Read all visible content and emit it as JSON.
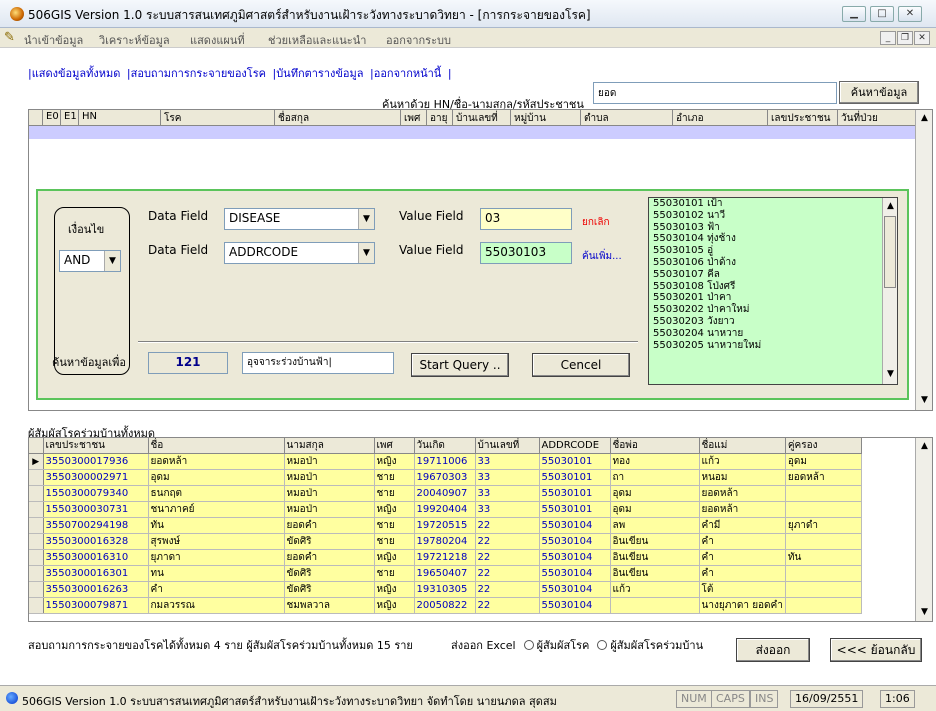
{
  "window": {
    "title": "506GIS Version 1.0  ระบบสารสนเทศภูมิศาสตร์สำหรับงานเฝ้าระวังทางระบาดวิทยา - [การกระจายของโรค]"
  },
  "menu": [
    "นำเข้าข้อมูล",
    "วิเคราะห์ข้อมูล",
    "แสดงแผนที่",
    "ช่วยเหลือและแนะนำ",
    "ออกจากระบบ"
  ],
  "nav": [
    "|แสดงข้อมูลทั้งหมด",
    "|สอบถามการกระจายของโรค",
    "|บันทึกตารางข้อมูล",
    "|ออกจากหน้านี้",
    "|"
  ],
  "search": {
    "label": "ค้นหาด้วย HN/ชื่อ-นามสกุล/รหัสประชาชน",
    "value": "ยอด",
    "button": "ค้นหาข้อมูล"
  },
  "grid1": {
    "headers": [
      "E0",
      "E1",
      "HN",
      "โรค",
      "ชื่อสกุล",
      "เพศ",
      "อายุ",
      "บ้านเลขที่",
      "หมู่บ้าน",
      "ตำบล",
      "อำเภอ",
      "เลขประชาชน",
      "วันที่ป่วย"
    ]
  },
  "query": {
    "condition_label": "เงื่อนไข",
    "operator": "AND",
    "data_field_label": "Data Field",
    "value_field_label": "Value Field",
    "field1": "DISEASE",
    "value1": "03",
    "cancel_link": "ยกเลิก",
    "field2": "ADDRCODE",
    "value2": "55030103",
    "more_link": "ค้นเพิ่ม...",
    "purpose_label": "ค้นหาข้อมูลเพื่อ",
    "count": "121",
    "purpose_value": "อุจจาระร่วงบ้านฟ้า|",
    "start_button": "Start Query ..",
    "cancel_button": "Cencel"
  },
  "villages": [
    "55030101 เป้า",
    "55030102 นาวี",
    "55030103 ฟ้า",
    "55030104 ทุ่งช้าง",
    "55030105 อู่",
    "55030106 ป่าด้าง",
    "55030107 คีล",
    "55030108 โป่งศรี",
    "55030201 ป่าคา",
    "55030202 ป่าคาใหม่",
    "55030203 วังยาว",
    "55030204 นาหวาย",
    "55030205 นาหวายใหม่"
  ],
  "grid2": {
    "label": "ผู้สัมผัสโรคร่วมบ้านทั้งหมด",
    "headers": [
      "เลขประชาชน",
      "ชื่อ",
      "นามสกุล",
      "เพศ",
      "วันเกิด",
      "บ้านเลขที่",
      "ADDRCODE",
      "ชื่อพ่อ",
      "ชื่อแม่",
      "คู่ครอง"
    ],
    "rows": [
      [
        "3550300017936",
        "ยอดหล้า",
        "หมอป่า",
        "หญิง",
        "19711006",
        "33",
        "55030101",
        "ทอง",
        "แก้ว",
        "อุดม"
      ],
      [
        "3550300002971",
        "อุดม",
        "หมอป่า",
        "ชาย",
        "19670303",
        "33",
        "55030101",
        "ถา",
        "หนอม",
        "ยอดหล้า"
      ],
      [
        "1550300079340",
        "ธนกฤต",
        "หมอป่า",
        "ชาย",
        "20040907",
        "33",
        "55030101",
        "อุดม",
        "ยอดหล้า",
        ""
      ],
      [
        "1550300030731",
        "ชนาภาคย์",
        "หมอป่า",
        "หญิง",
        "19920404",
        "33",
        "55030101",
        "อุดม",
        "ยอดหล้า",
        ""
      ],
      [
        "3550700294198",
        "ทัน",
        "ยอดคำ",
        "ชาย",
        "19720515",
        "22",
        "55030104",
        "ลพ",
        "คำมี",
        "ยุภาดำ"
      ],
      [
        "3550300016328",
        "สุรพงษ์",
        "ขัดศิริ",
        "ชาย",
        "19780204",
        "22",
        "55030104",
        "อินเขียน",
        "คำ",
        ""
      ],
      [
        "3550300016310",
        "ยุภาดา",
        "ยอดคำ",
        "หญิง",
        "19721218",
        "22",
        "55030104",
        "อินเขียน",
        "คำ",
        "ทัน"
      ],
      [
        "3550300016301",
        "ทน",
        "ขัดศิริ",
        "ชาย",
        "19650407",
        "22",
        "55030104",
        "อินเขียน",
        "คำ",
        ""
      ],
      [
        "3550300016263",
        "คำ",
        "ขัดศิริ",
        "หญิง",
        "19310305",
        "22",
        "55030104",
        "แก้ว",
        "โต้",
        ""
      ],
      [
        "1550300079871",
        "กมลวรรณ",
        "ชมพลวาล",
        "หญิง",
        "20050822",
        "22",
        "55030104",
        "",
        "นางยุภาดา  ยอดคำ",
        ""
      ]
    ]
  },
  "summary": "สอบถามการกระจายของโรคได้ทั้งหมด 4 ราย   ผู้สัมผัสโรคร่วมบ้านทั้งหมด 15 ราย",
  "export": {
    "label": "ส่งออก Excel",
    "opt1": "ผู้สัมผัสโรค",
    "opt2": "ผู้สัมผัสโรคร่วมบ้าน",
    "button": "ส่งออก",
    "back": "<<< ย้อนกลับ"
  },
  "status": {
    "text": "506GIS Version 1.0 ระบบสารสนเทศภูมิศาสตร์สำหรับงานเฝ้าระวังทางระบาดวิทยา จัดทำโดย นายนภดล สุดสม",
    "num": "NUM",
    "caps": "CAPS",
    "ins": "INS",
    "date": "16/09/2551",
    "time": "1:06"
  }
}
